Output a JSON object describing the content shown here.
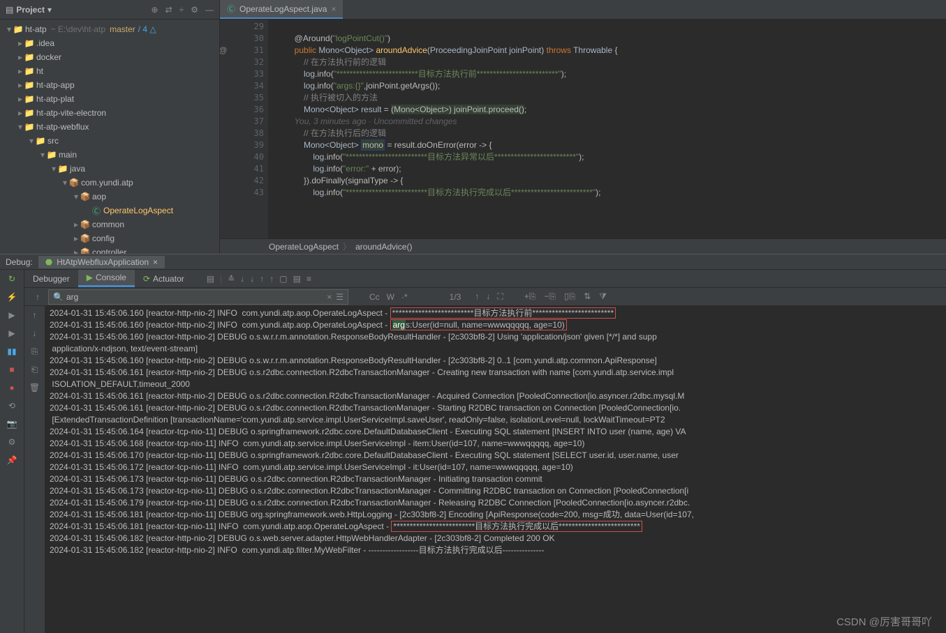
{
  "sidebar": {
    "title": "Project",
    "head_icons": [
      "⊕",
      "⇄",
      "÷",
      "⚙",
      "—"
    ],
    "tree": [
      {
        "depth": 0,
        "chev": "▾",
        "ic": "📁",
        "cls": "module-ic",
        "lbl": "ht-atp",
        "tail": "~ E:\\dev\\ht-atp",
        "master": "master",
        "delta": "/ 4 △"
      },
      {
        "depth": 1,
        "chev": "▸",
        "ic": "📁",
        "cls": "folder-ic",
        "lbl": ".idea"
      },
      {
        "depth": 1,
        "chev": "▸",
        "ic": "📁",
        "cls": "folder-ic",
        "lbl": "docker"
      },
      {
        "depth": 1,
        "chev": "▸",
        "ic": "📁",
        "cls": "folder-ic",
        "lbl": "ht"
      },
      {
        "depth": 1,
        "chev": "▸",
        "ic": "📁",
        "cls": "module-ic",
        "lbl": "ht-atp-app"
      },
      {
        "depth": 1,
        "chev": "▸",
        "ic": "📁",
        "cls": "module-ic",
        "lbl": "ht-atp-plat"
      },
      {
        "depth": 1,
        "chev": "▸",
        "ic": "📁",
        "cls": "module-ic",
        "lbl": "ht-atp-vite-electron"
      },
      {
        "depth": 1,
        "chev": "▾",
        "ic": "📁",
        "cls": "module-ic",
        "lbl": "ht-atp-webflux"
      },
      {
        "depth": 2,
        "chev": "▾",
        "ic": "📁",
        "cls": "folder-ic",
        "lbl": "src"
      },
      {
        "depth": 3,
        "chev": "▾",
        "ic": "📁",
        "cls": "folder-ic",
        "lbl": "main"
      },
      {
        "depth": 4,
        "chev": "▾",
        "ic": "📁",
        "cls": "java-ic",
        "lbl": "java"
      },
      {
        "depth": 5,
        "chev": "▾",
        "ic": "📦",
        "cls": "package-ic",
        "lbl": "com.yundi.atp"
      },
      {
        "depth": 6,
        "chev": "▾",
        "ic": "📦",
        "cls": "package-ic",
        "lbl": "aop"
      },
      {
        "depth": 7,
        "chev": " ",
        "ic": "Ⓒ",
        "cls": "class-ic",
        "lbl": "OperateLogAspect",
        "sel": true
      },
      {
        "depth": 6,
        "chev": "▸",
        "ic": "📦",
        "cls": "package-ic",
        "lbl": "common"
      },
      {
        "depth": 6,
        "chev": "▸",
        "ic": "📦",
        "cls": "package-ic",
        "lbl": "config"
      },
      {
        "depth": 6,
        "chev": "▸",
        "ic": "📦",
        "cls": "package-ic",
        "lbl": "controller"
      }
    ]
  },
  "tab": {
    "label": "OperateLogAspect.java",
    "close": "×"
  },
  "gutter": {
    "start": 29,
    "end": 43,
    "marker_line": 31,
    "marker": "👤 @"
  },
  "code": {
    "lines": [
      "",
      "        <span class='ann'>@Around</span>(<span class='str'>\"logPointCut()\"</span>)",
      "        <span class='kw'>public</span> <span class='id'>Mono&lt;Object&gt;</span> <span class='meth'>aroundAdvice</span>(<span class='id'>ProceedingJoinPoint joinPoint</span>) <span class='kw'>throws</span> <span class='id'>Throwable</span> {",
      "            <span class='cm'>// 在方法执行前的逻辑</span>",
      "            <span class='id'>log</span>.info(<span class='str'>\"*************************目标方法执行前*************************\"</span>);",
      "            <span class='id'>log</span>.info(<span class='str'>\"args:{}\"</span>,joinPoint.getArgs());",
      "            <span class='cm'>// 执行被切入的方法</span>",
      "            <span class='id'>Mono&lt;Object&gt; result</span> = <span class='cast-hl'>(Mono&lt;Object&gt;) joinPoint.proceed()</span>;",
      "        <span class='author'>You, 3 minutes ago · Uncommitted changes</span>",
      "            <span class='cm'>// 在方法执行后的逻辑</span>",
      "            <span class='id'>Mono&lt;Object&gt;</span> <span class='id-hl'>mono</span> = result.doOnError(error -&gt; {",
      "                <span class='id'>log</span>.info(<span class='str'>\"*************************目标方法异常以后*************************\"</span>);",
      "                <span class='id'>log</span>.info(<span class='str'>\"error:\"</span> + error);",
      "            }).doFinally(signalType -&gt; {",
      "                <span class='id'>log</span>.info(<span class='str'>\"*************************目标方法执行完成以后*************************\"</span>);"
    ]
  },
  "breadcrumb": {
    "a": "OperateLogAspect",
    "b": "aroundAdvice()"
  },
  "debug": {
    "label": "Debug:",
    "run_config": "HtAtpWebfluxApplication",
    "close": "×",
    "tabs": {
      "debugger": "Debugger",
      "console": "Console",
      "actuator": "Actuator"
    },
    "search": {
      "value": "arg",
      "count": "1/3",
      "cc": "Cc",
      "w": "W",
      "star": "·*"
    },
    "left_icons": [
      "↻",
      "⚡",
      "▶",
      "▶",
      "▮▮",
      "■",
      "●",
      "⟲",
      "📷",
      "⚙",
      "📌"
    ],
    "console_gutter": [
      "↑",
      "↓",
      "⎘",
      "⎗",
      "🗑"
    ],
    "logs": [
      {
        "t": "2024-01-31 15:45:06.160 [reactor-http-nio-2] INFO  com.yundi.atp.aop.OperateLogAspect - ",
        "box": "*************************目标方法执行前*************************"
      },
      {
        "t": "2024-01-31 15:45:06.160 [reactor-http-nio-2] INFO  com.yundi.atp.aop.OperateLogAspect - ",
        "green": "arg",
        "box2": "s:User(id=null, name=wwwqqqqq, age=10)"
      },
      {
        "t": "2024-01-31 15:45:06.160 [reactor-http-nio-2] DEBUG o.s.w.r.r.m.annotation.ResponseBodyResultHandler - [2c303bf8-2] Using 'application/json' given [*/*] and supp"
      },
      {
        "t": " application/x-ndjson, text/event-stream]"
      },
      {
        "t": "2024-01-31 15:45:06.160 [reactor-http-nio-2] DEBUG o.s.w.r.r.m.annotation.ResponseBodyResultHandler - [2c303bf8-2] 0..1 [com.yundi.atp.common.ApiResponse<?>]"
      },
      {
        "t": "2024-01-31 15:45:06.161 [reactor-http-nio-2] DEBUG o.s.r2dbc.connection.R2dbcTransactionManager - Creating new transaction with name [com.yundi.atp.service.impl"
      },
      {
        "t": " ISOLATION_DEFAULT,timeout_2000"
      },
      {
        "t": "2024-01-31 15:45:06.161 [reactor-http-nio-2] DEBUG o.s.r2dbc.connection.R2dbcTransactionManager - Acquired Connection [PooledConnection[io.asyncer.r2dbc.mysql.M"
      },
      {
        "t": "2024-01-31 15:45:06.161 [reactor-http-nio-2] DEBUG o.s.r2dbc.connection.R2dbcTransactionManager - Starting R2DBC transaction on Connection [PooledConnection[io."
      },
      {
        "t": " [ExtendedTransactionDefinition [transactionName='com.yundi.atp.service.impl.UserServiceImpl.saveUser', readOnly=false, isolationLevel=null, lockWaitTimeout=PT2"
      },
      {
        "t": "2024-01-31 15:45:06.164 [reactor-tcp-nio-11] DEBUG o.springframework.r2dbc.core.DefaultDatabaseClient - Executing SQL statement [INSERT INTO user (name, age) VA"
      },
      {
        "t": "2024-01-31 15:45:06.168 [reactor-tcp-nio-11] INFO  com.yundi.atp.service.impl.UserServiceImpl - item:User(id=107, name=wwwqqqqq, age=10)"
      },
      {
        "t": "2024-01-31 15:45:06.170 [reactor-tcp-nio-11] DEBUG o.springframework.r2dbc.core.DefaultDatabaseClient - Executing SQL statement [SELECT user.id, user.name, user"
      },
      {
        "t": "2024-01-31 15:45:06.172 [reactor-tcp-nio-11] INFO  com.yundi.atp.service.impl.UserServiceImpl - it:User(id=107, name=wwwqqqqq, age=10)"
      },
      {
        "t": "2024-01-31 15:45:06.173 [reactor-tcp-nio-11] DEBUG o.s.r2dbc.connection.R2dbcTransactionManager - Initiating transaction commit"
      },
      {
        "t": "2024-01-31 15:45:06.173 [reactor-tcp-nio-11] DEBUG o.s.r2dbc.connection.R2dbcTransactionManager - Committing R2DBC transaction on Connection [PooledConnection[i"
      },
      {
        "t": "2024-01-31 15:45:06.179 [reactor-tcp-nio-11] DEBUG o.s.r2dbc.connection.R2dbcTransactionManager - Releasing R2DBC Connection [PooledConnection[io.asyncer.r2dbc."
      },
      {
        "t": "2024-01-31 15:45:06.181 [reactor-tcp-nio-11] DEBUG org.springframework.web.HttpLogging - [2c303bf8-2] Encoding [ApiResponse(code=200, msg=成功, data=User(id=107,"
      },
      {
        "t": "2024-01-31 15:45:06.181 [reactor-tcp-nio-11] INFO  com.yundi.atp.aop.OperateLogAspect - ",
        "box": "*************************目标方法执行完成以后*************************"
      },
      {
        "t": "2024-01-31 15:45:06.182 [reactor-http-nio-2] DEBUG o.s.web.server.adapter.HttpWebHandlerAdapter - [2c303bf8-2] Completed 200 OK"
      },
      {
        "t": "2024-01-31 15:45:06.182 [reactor-http-nio-2] INFO  com.yundi.atp.filter.MyWebFilter - ------------------目标方法执行完成以后---------------"
      }
    ]
  },
  "watermark": "CSDN @厉害哥哥吖"
}
